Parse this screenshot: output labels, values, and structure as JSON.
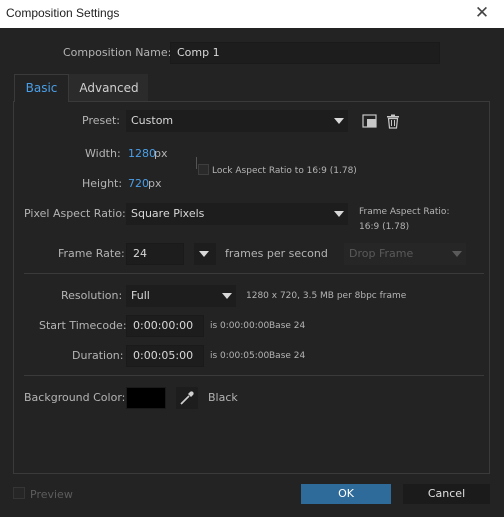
{
  "window": {
    "title": "Composition Settings",
    "close": "✕"
  },
  "comp_name": {
    "label": "Composition Name:",
    "value": "Comp 1"
  },
  "tabs": [
    {
      "label": "Basic"
    },
    {
      "label": "Advanced"
    }
  ],
  "preset": {
    "label": "Preset:",
    "value": "Custom"
  },
  "width": {
    "label": "Width:",
    "value": "1280",
    "unit": "px"
  },
  "height": {
    "label": "Height:",
    "value": "720",
    "unit": "px"
  },
  "lock_aspect": {
    "label": "Lock Aspect Ratio to 16:9 (1.78)",
    "checked": false
  },
  "pixel_aspect": {
    "label": "Pixel Aspect Ratio:",
    "value": "Square Pixels"
  },
  "frame_aspect": {
    "label": "Frame Aspect Ratio:",
    "value": "16:9 (1.78)"
  },
  "frame_rate": {
    "label": "Frame Rate:",
    "value": "24",
    "unit": "frames per second",
    "drop_frame": "Drop Frame"
  },
  "resolution": {
    "label": "Resolution:",
    "value": "Full",
    "info": "1280 x 720, 3.5 MB per 8bpc frame"
  },
  "start_timecode": {
    "label": "Start Timecode:",
    "value": "0:00:00:00",
    "is_text": "is 0:00:00:00",
    "base": "Base 24"
  },
  "duration": {
    "label": "Duration:",
    "value": "0:00:05:00",
    "is_text": "is 0:00:05:00",
    "base": "Base 24"
  },
  "background": {
    "label": "Background Color:",
    "color": "#000000",
    "name": "Black"
  },
  "footer": {
    "preview_label": "Preview",
    "ok_label": "OK",
    "cancel_label": "Cancel"
  },
  "colors": {
    "accent": "#4a9fe8",
    "ok_button": "#2f6b9a",
    "background": "#232323"
  }
}
